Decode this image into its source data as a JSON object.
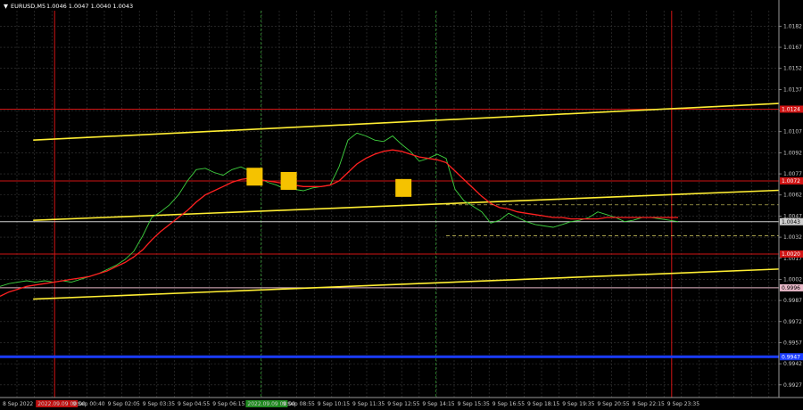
{
  "header": {
    "symbol": "EURUSD,M5",
    "ohlc": "1.0046 1.0047 1.0040 1.0043"
  },
  "chart_data": {
    "type": "line",
    "title": "EURUSD,M5",
    "ylim": [
      0.9918,
      1.0193
    ],
    "y_ticks": [
      "1.0182",
      "1.0167",
      "1.0152",
      "1.0137",
      "1.0122",
      "1.0107",
      "1.0092",
      "1.0077",
      "1.0062",
      "1.0047",
      "1.0032",
      "1.0017",
      "1.0002",
      "0.9987",
      "0.9972",
      "0.9957",
      "0.9942",
      "0.9927"
    ],
    "x_ticks": [
      "8 Sep 2022",
      "2022.09.09 00:00",
      "9 Sep 00:40",
      "9 Sep 02:05",
      "9 Sep 03:35",
      "9 Sep 04:55",
      "9 Sep 06:15",
      "2022.09.09 08:00",
      "9 Sep 08:55",
      "9 Sep 10:15",
      "9 Sep 11:35",
      "9 Sep 12:55",
      "9 Sep 14:15",
      "9 Sep 15:35",
      "9 Sep 16:55",
      "9 Sep 18:15",
      "9 Sep 19:35",
      "9 Sep 20:55",
      "9 Sep 22:15",
      "9 Sep 23:35"
    ],
    "series": [
      {
        "color": "#3fd13f",
        "values": [
          0.9997,
          0.9999,
          1.0,
          1.0001,
          1.0,
          1.0001,
          1.0,
          1.0001,
          1.0,
          1.0002,
          1.0004,
          1.0006,
          1.0009,
          1.0012,
          1.0016,
          1.0022,
          1.0033,
          1.0046,
          1.005,
          1.0055,
          1.0062,
          1.0072,
          1.008,
          1.0081,
          1.0078,
          1.0076,
          1.008,
          1.0082,
          1.0079,
          1.0074,
          1.0071,
          1.0069,
          1.0066,
          1.0066,
          1.0065,
          1.0067,
          1.0068,
          1.0069,
          1.0082,
          1.0101,
          1.0106,
          1.0104,
          1.0101,
          1.01,
          1.0104,
          1.0098,
          1.0093,
          1.0086,
          1.0088,
          1.0091,
          1.0088,
          1.0066,
          1.0058,
          1.0054,
          1.005,
          1.0042,
          1.0044,
          1.0049,
          1.0046,
          1.0043,
          1.0041,
          1.004,
          1.0039,
          1.0041,
          1.0043,
          1.0044,
          1.0046,
          1.005,
          1.0048,
          1.0046,
          1.0043,
          1.0044,
          1.0046,
          1.0046,
          1.0045,
          1.0044,
          1.0043
        ]
      },
      {
        "color": "#ff2020",
        "values": [
          0.999,
          0.9993,
          0.9995,
          0.9997,
          0.9998,
          0.9999,
          1.0,
          1.0001,
          1.0002,
          1.0003,
          1.0004,
          1.0006,
          1.0008,
          1.0011,
          1.0014,
          1.0018,
          1.0023,
          1.003,
          1.0036,
          1.0041,
          1.0046,
          1.0051,
          1.0057,
          1.0062,
          1.0065,
          1.0068,
          1.0071,
          1.0073,
          1.0074,
          1.0073,
          1.0072,
          1.0071,
          1.007,
          1.0069,
          1.0068,
          1.0068,
          1.0068,
          1.0069,
          1.0072,
          1.0078,
          1.0084,
          1.0088,
          1.0091,
          1.0093,
          1.0094,
          1.0093,
          1.0091,
          1.0089,
          1.0088,
          1.0087,
          1.0085,
          1.0079,
          1.0073,
          1.0067,
          1.0061,
          1.0056,
          1.0053,
          1.0052,
          1.005,
          1.0049,
          1.0048,
          1.0047,
          1.0046,
          1.0046,
          1.0045,
          1.0045,
          1.0045,
          1.0045,
          1.0046,
          1.0046,
          1.0046,
          1.0046,
          1.0046,
          1.0046,
          1.0046,
          1.0046,
          1.0046
        ]
      }
    ],
    "horizontal_levels": [
      {
        "value": 1.0123,
        "color": "#d01414",
        "label": "1.0124"
      },
      {
        "value": 1.0072,
        "color": "#d01414",
        "label": "1.0072"
      },
      {
        "value": 1.0043,
        "color": "#cfcfcf",
        "label": "1.0043"
      },
      {
        "value": 1.002,
        "color": "#d01414",
        "label": "1.0020"
      },
      {
        "value": 0.9996,
        "color": "#e8b8c8",
        "label": "0.9996"
      },
      {
        "value": 0.9947,
        "color": "#1a3cff",
        "label": "0.9947"
      }
    ],
    "trend_lines": [
      {
        "from": [
          "2022.09.09 00:00",
          1.0101
        ],
        "to": [
          "9 Sep 23:35",
          1.0123
        ],
        "color": "#ffee33"
      },
      {
        "from": [
          "2022.09.09 00:00",
          1.0044
        ],
        "to": [
          "9 Sep 23:35",
          1.0062
        ],
        "color": "#ffee33"
      },
      {
        "from": [
          "2022.09.09 00:00",
          0.9988
        ],
        "to": [
          "9 Sep 23:35",
          1.0006
        ],
        "color": "#ffee33"
      }
    ],
    "signal_boxes": [
      "2022.09.09 08:00",
      "9 Sep 08:55",
      "9 Sep 12:55"
    ],
    "grid": true
  },
  "colors": {
    "background": "#000000",
    "grid": "#3a3a3a",
    "axis": "#9a9a9a",
    "session": "#d01414",
    "signal": "#f5c200"
  }
}
